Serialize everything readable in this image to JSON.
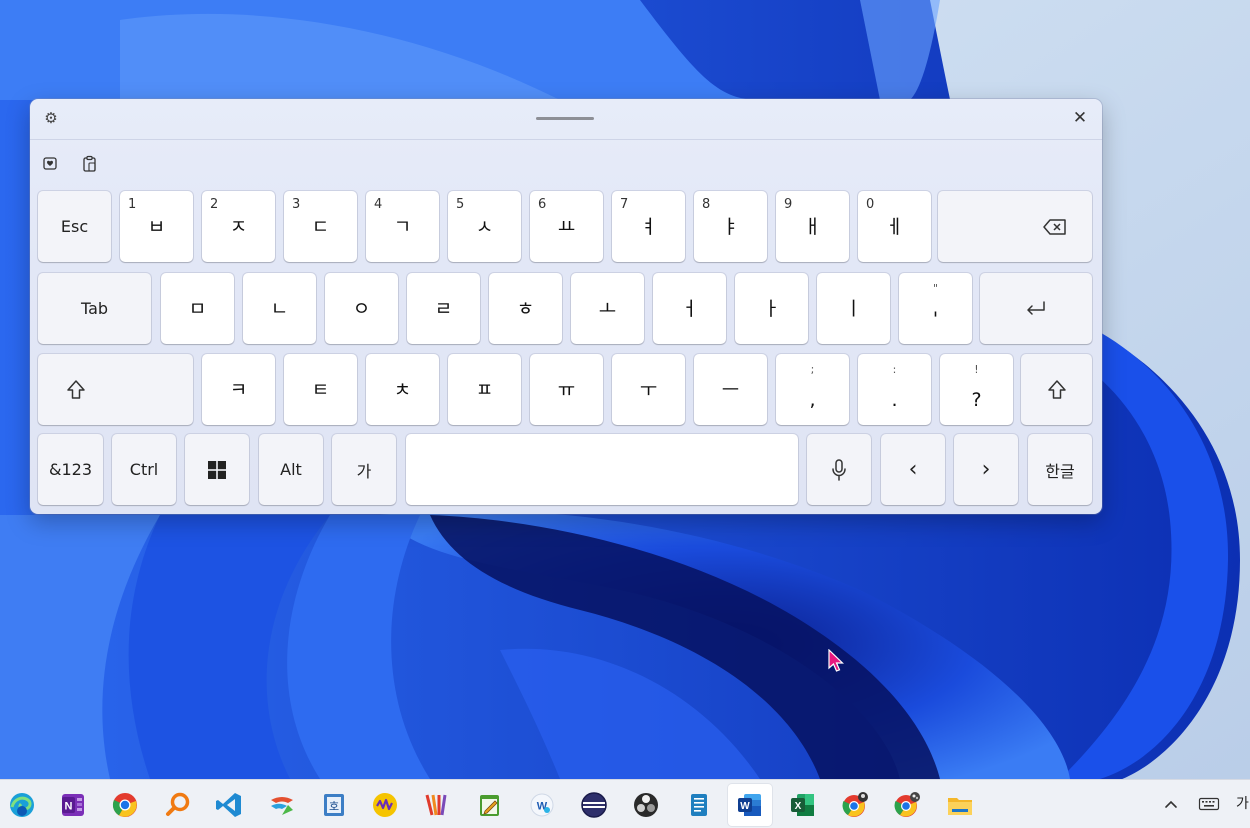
{
  "keyboard": {
    "row1": {
      "esc": "Esc",
      "keys": [
        {
          "num": "1",
          "char": "ㅂ"
        },
        {
          "num": "2",
          "char": "ㅈ"
        },
        {
          "num": "3",
          "char": "ㄷ"
        },
        {
          "num": "4",
          "char": "ㄱ"
        },
        {
          "num": "5",
          "char": "ㅅ"
        },
        {
          "num": "6",
          "char": "ㅛ"
        },
        {
          "num": "7",
          "char": "ㅕ"
        },
        {
          "num": "8",
          "char": "ㅑ"
        },
        {
          "num": "9",
          "char": "ㅐ"
        },
        {
          "num": "0",
          "char": "ㅔ"
        }
      ]
    },
    "row2": {
      "tab": "Tab",
      "keys": [
        "ㅁ",
        "ㄴ",
        "ㅇ",
        "ㄹ",
        "ㅎ",
        "ㅗ",
        "ㅓ",
        "ㅏ",
        "ㅣ"
      ],
      "punct": {
        "top": "\"",
        "bottom": "'"
      }
    },
    "row3": {
      "keys": [
        "ㅋ",
        "ㅌ",
        "ㅊ",
        "ㅍ",
        "ㅠ",
        "ㅜ",
        "ㅡ"
      ],
      "punct": [
        {
          "top": ";",
          "bottom": ","
        },
        {
          "top": ":",
          "bottom": "."
        },
        {
          "top": "!",
          "bottom": "?"
        }
      ]
    },
    "row4": {
      "symbols": "&123",
      "ctrl": "Ctrl",
      "alt": "Alt",
      "hanja": "가",
      "left_arrow": "‹",
      "right_arrow": "›",
      "lang": "한글"
    },
    "icons": {
      "settings": "gear-icon",
      "close": "close-icon",
      "emoji": "emoji-sticker-icon",
      "clipboard": "clipboard-icon",
      "backspace": "backspace-icon",
      "enter": "enter-icon",
      "shift": "shift-icon",
      "windows": "windows-logo-icon",
      "mic": "microphone-icon"
    },
    "close_glyph": "✕",
    "gear_glyph": "⚙"
  },
  "taskbar": {
    "tray_input_indicator": "가",
    "icons": [
      "edge",
      "onenote",
      "chrome",
      "search-magnifier",
      "vscode",
      "app-swirl",
      "notepad-korean",
      "app-wave",
      "app-stripes",
      "notepad-edit",
      "app-word-circle",
      "app-disc",
      "obs",
      "notes",
      "word",
      "excel",
      "chrome-profile-1",
      "chrome-profile-2",
      "file-explorer"
    ]
  },
  "colors": {
    "accent_blue": "#1f4fe0",
    "keyboard_bg": "#e3e8f6",
    "key_bg": "#ffffff",
    "cursor_pink": "#e8177f"
  }
}
